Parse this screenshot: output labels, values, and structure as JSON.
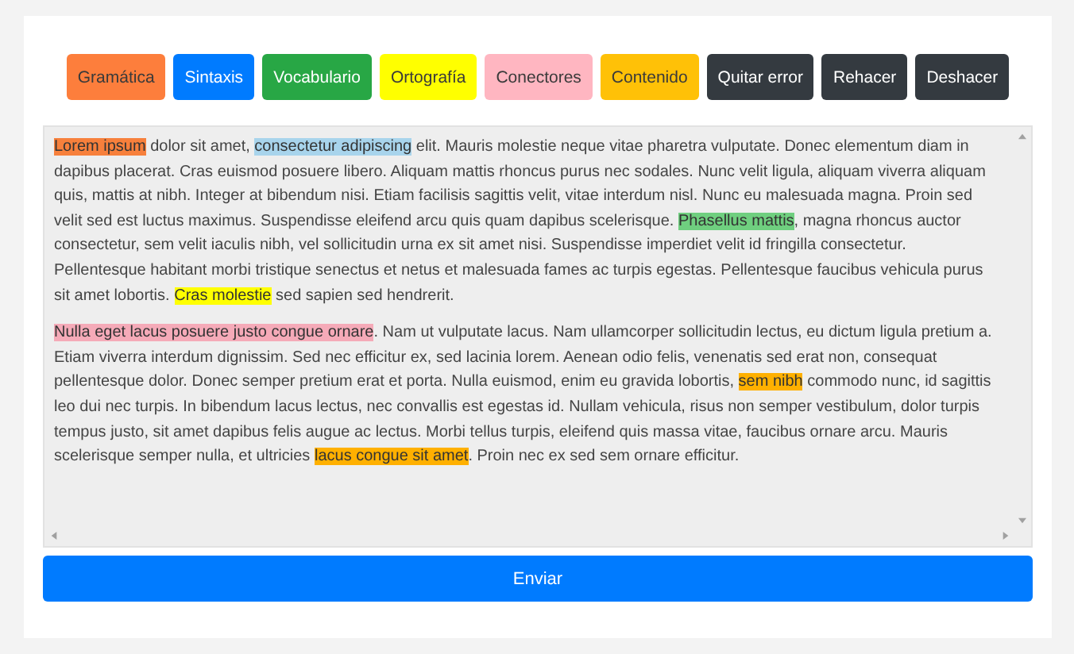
{
  "toolbar": [
    {
      "label": "Gramática",
      "color": "#fd7e3c"
    },
    {
      "label": "Sintaxis",
      "color": "#007bff"
    },
    {
      "label": "Vocabulario",
      "color": "#28a745"
    },
    {
      "label": "Ortografía",
      "color": "#ffff00"
    },
    {
      "label": "Conectores",
      "color": "#ffb6c1"
    },
    {
      "label": "Contenido",
      "color": "#ffc107"
    },
    {
      "label": "Quitar error",
      "color": "#343a40"
    },
    {
      "label": "Rehacer",
      "color": "#343a40"
    },
    {
      "label": "Deshacer",
      "color": "#343a40"
    }
  ],
  "editor": {
    "paragraphs": [
      [
        {
          "text": "Lorem ipsum",
          "color": "#f7803c"
        },
        {
          "text": " dolor sit amet, "
        },
        {
          "text": "consectetur adipiscing",
          "color": "#a8d4ec"
        },
        {
          "text": " elit. Mauris molestie neque vitae pharetra vulputate. Donec elementum diam in dapibus placerat. Cras euismod posuere libero. Aliquam mattis rhoncus purus nec sodales. Nunc velit ligula, aliquam viverra aliquam quis, mattis at nibh. Integer at bibendum nisi. Etiam facilisis sagittis velit, vitae interdum nisl. Nunc eu malesuada magna. Proin sed velit sed est luctus maximus. Suspendisse eleifend arcu quis quam dapibus scelerisque. "
        },
        {
          "text": "Phasellus mattis",
          "color": "#6fcf7f"
        },
        {
          "text": ", magna rhoncus auctor consectetur, sem velit iaculis nibh, vel sollicitudin urna ex sit amet nisi. Suspendisse imperdiet velit id fringilla consectetur. Pellentesque habitant morbi tristique senectus et netus et malesuada fames ac turpis egestas. Pellentesque faucibus vehicula purus sit amet lobortis. "
        },
        {
          "text": "Cras molestie",
          "color": "#ffff00"
        },
        {
          "text": " sed sapien sed hendrerit."
        }
      ],
      [
        {
          "text": "Nulla eget lacus posuere justo congue ornare",
          "color": "#f5aab8"
        },
        {
          "text": ". Nam ut vulputate lacus. Nam ullamcorper sollicitudin lectus, eu dictum ligula pretium a. Etiam viverra interdum dignissim. Sed nec efficitur ex, sed lacinia lorem. Aenean odio felis, venenatis sed erat non, consequat pellentesque dolor. Donec semper pretium erat et porta. Nulla euismod, enim eu gravida lobortis, "
        },
        {
          "text": "sem nibh",
          "color": "#ffb000"
        },
        {
          "text": " commodo nunc, id sagittis leo dui nec turpis. In bibendum lacus lectus, nec convallis est egestas id. Nullam vehicula, risus non semper vestibulum, dolor turpis tempus justo, sit amet dapibus felis augue ac lectus. Morbi tellus turpis, eleifend quis massa vitae, faucibus ornare arcu. Mauris scelerisque semper nulla, et ultricies "
        },
        {
          "text": "lacus congue sit amet",
          "color": "#ffb000"
        },
        {
          "text": ". Proin nec ex sed sem ornare efficitur."
        }
      ]
    ]
  },
  "submit": {
    "label": "Enviar"
  }
}
